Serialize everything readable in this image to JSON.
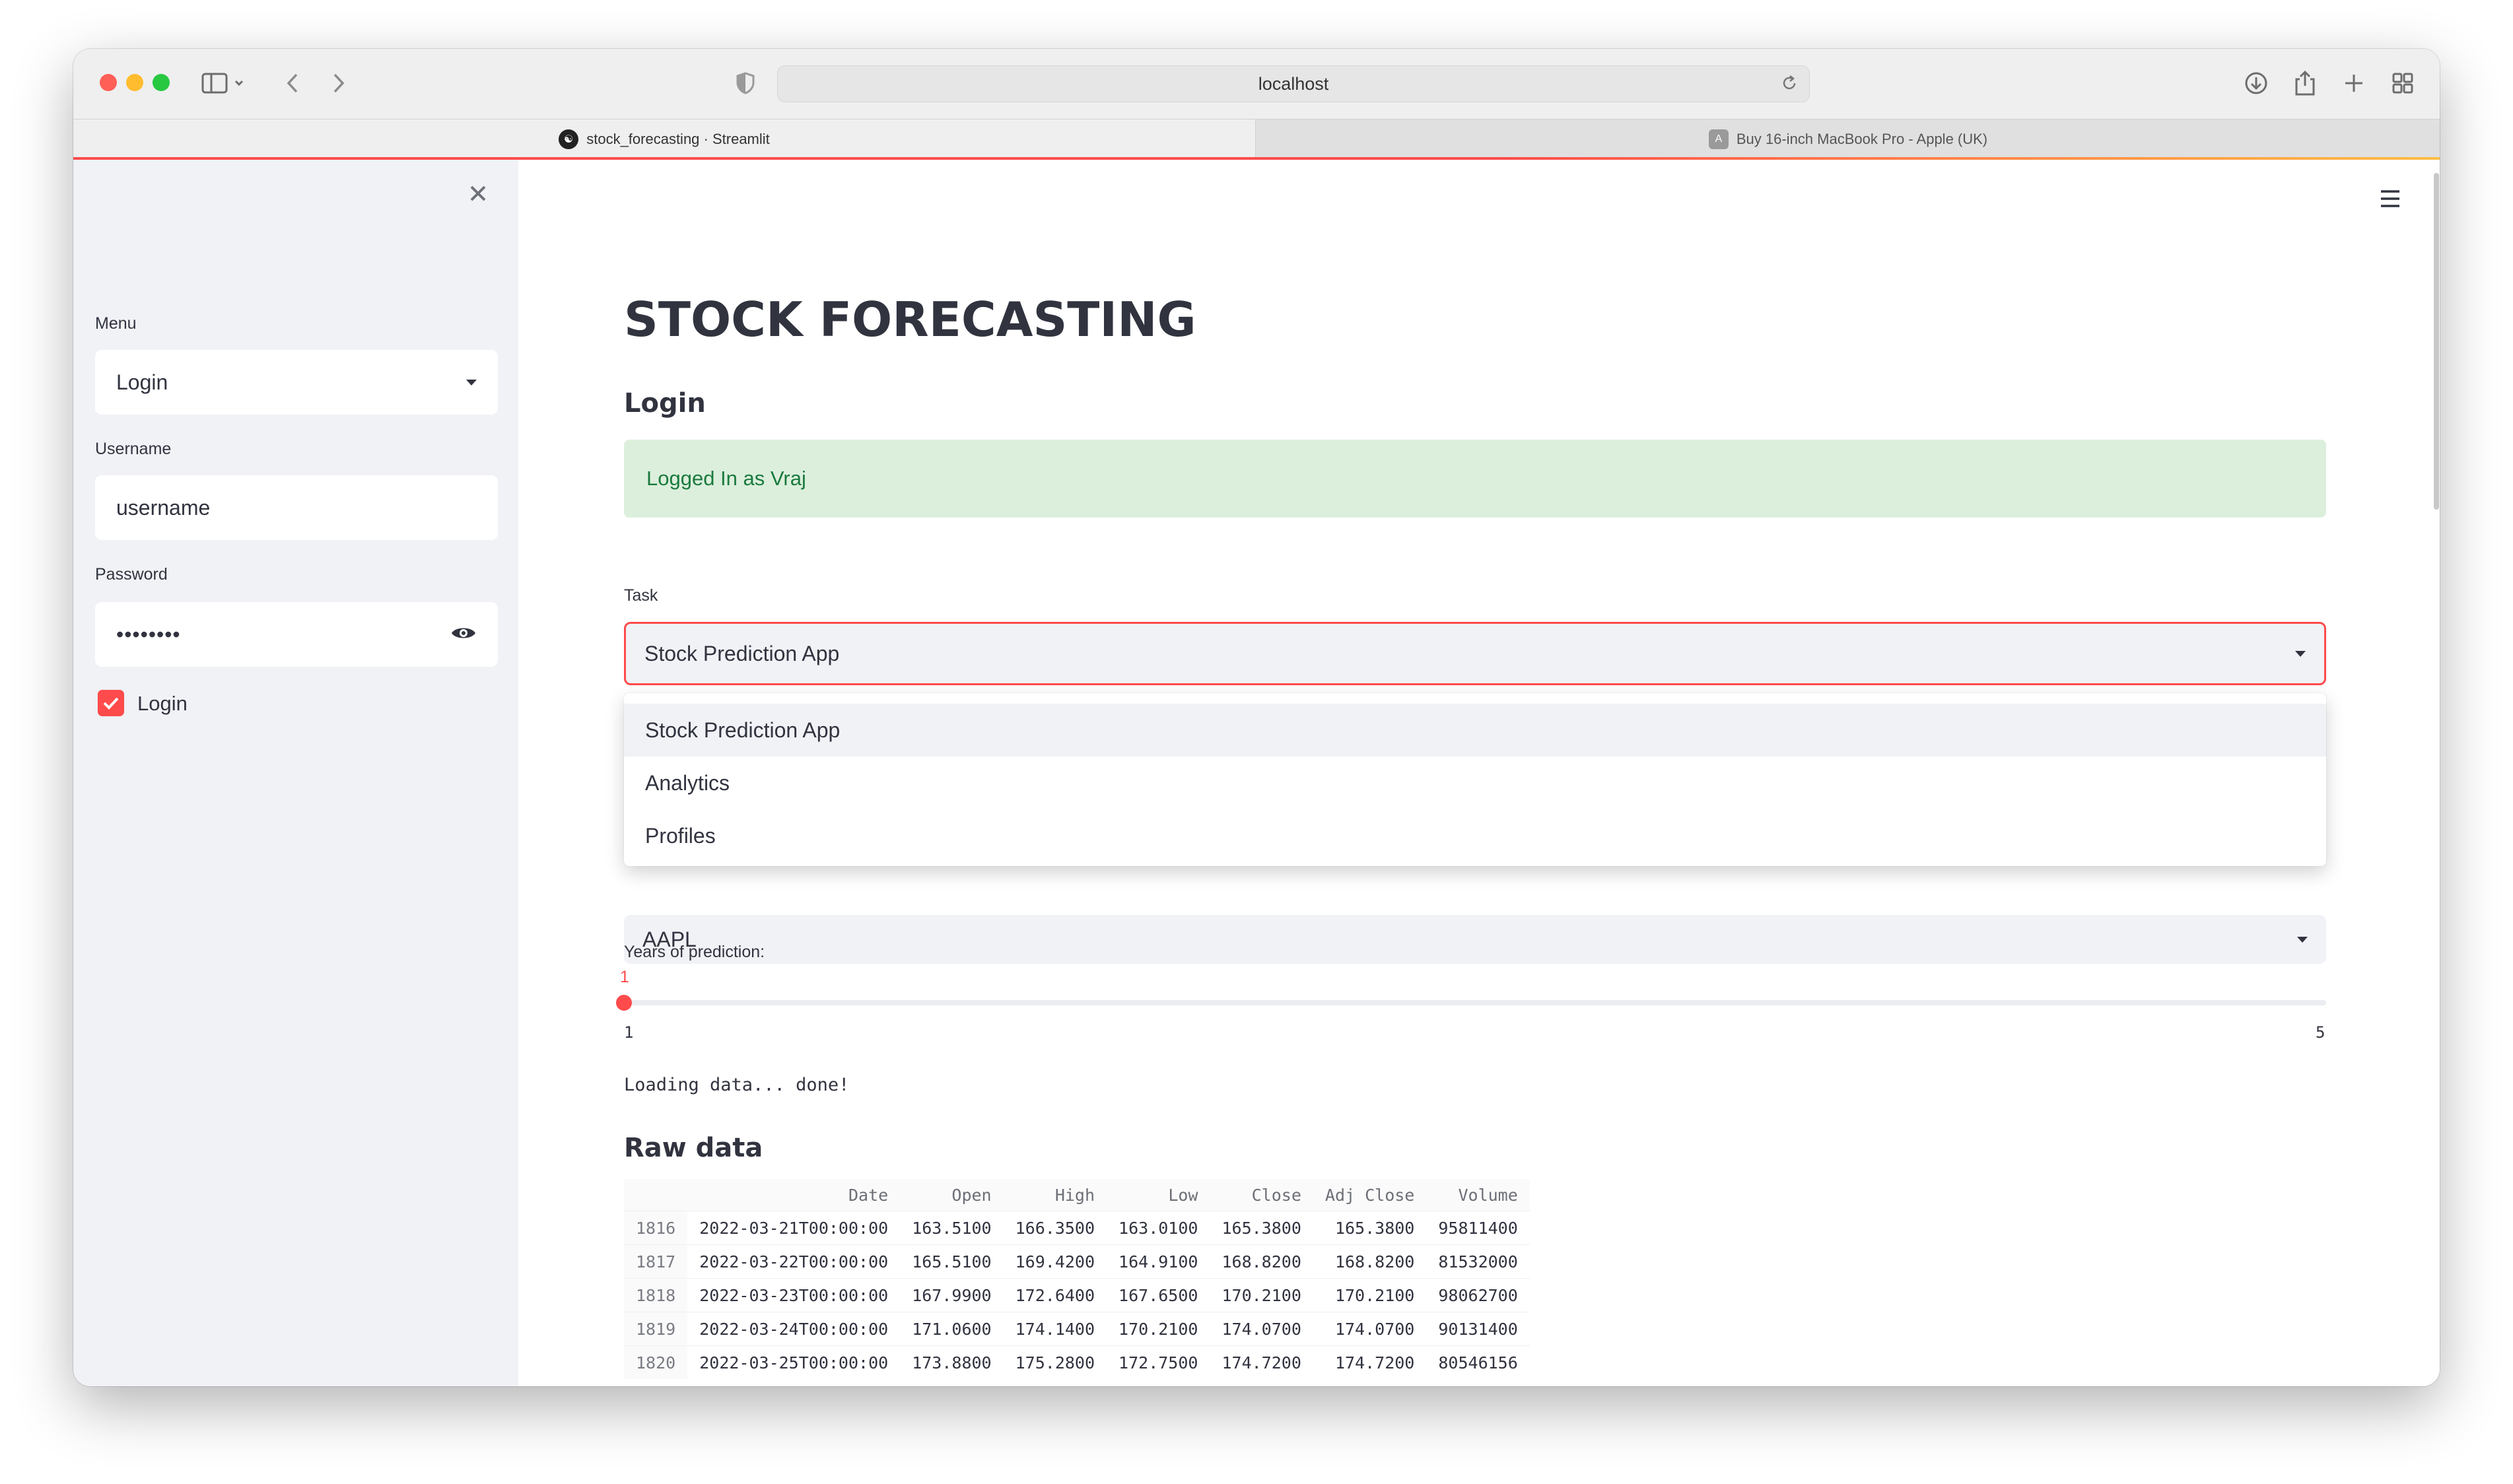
{
  "browser": {
    "url": "localhost",
    "tabs": [
      {
        "title": "stock_forecasting · Streamlit"
      },
      {
        "title": "Buy 16-inch MacBook Pro - Apple (UK)"
      }
    ]
  },
  "sidebar": {
    "menu_label": "Menu",
    "menu_value": "Login",
    "username_label": "Username",
    "username_value": "username",
    "password_label": "Password",
    "password_value": "••••••••",
    "login_checkbox_label": "Login",
    "login_checked": true
  },
  "main": {
    "title": "STOCK FORECASTING",
    "subheader": "Login",
    "success_message": "Logged In as Vraj",
    "task_label": "Task",
    "task_value": "Stock Prediction App",
    "task_options": [
      "Stock Prediction App",
      "Analytics",
      "Profiles"
    ],
    "stock_value": "AAPL",
    "slider": {
      "label": "Years of prediction:",
      "value": "1",
      "min": "1",
      "max": "5",
      "fraction": 0
    },
    "loading_text": "Loading data... done!",
    "raw_data_heading": "Raw data",
    "table": {
      "columns": [
        "",
        "Date",
        "Open",
        "High",
        "Low",
        "Close",
        "Adj Close",
        "Volume"
      ],
      "rows": [
        [
          "1816",
          "2022-03-21T00:00:00",
          "163.5100",
          "166.3500",
          "163.0100",
          "165.3800",
          "165.3800",
          "95811400"
        ],
        [
          "1817",
          "2022-03-22T00:00:00",
          "165.5100",
          "169.4200",
          "164.9100",
          "168.8200",
          "168.8200",
          "81532000"
        ],
        [
          "1818",
          "2022-03-23T00:00:00",
          "167.9900",
          "172.6400",
          "167.6500",
          "170.2100",
          "170.2100",
          "98062700"
        ],
        [
          "1819",
          "2022-03-24T00:00:00",
          "171.0600",
          "174.1400",
          "170.2100",
          "174.0700",
          "174.0700",
          "90131400"
        ],
        [
          "1820",
          "2022-03-25T00:00:00",
          "173.8800",
          "175.2800",
          "172.7500",
          "174.7200",
          "174.7200",
          "80546156"
        ]
      ]
    }
  },
  "colors": {
    "accent": "#ff4b4b",
    "success_bg": "#dcefdc",
    "success_text": "#1a7a3e",
    "sidebar_bg": "#f0f2f6"
  }
}
